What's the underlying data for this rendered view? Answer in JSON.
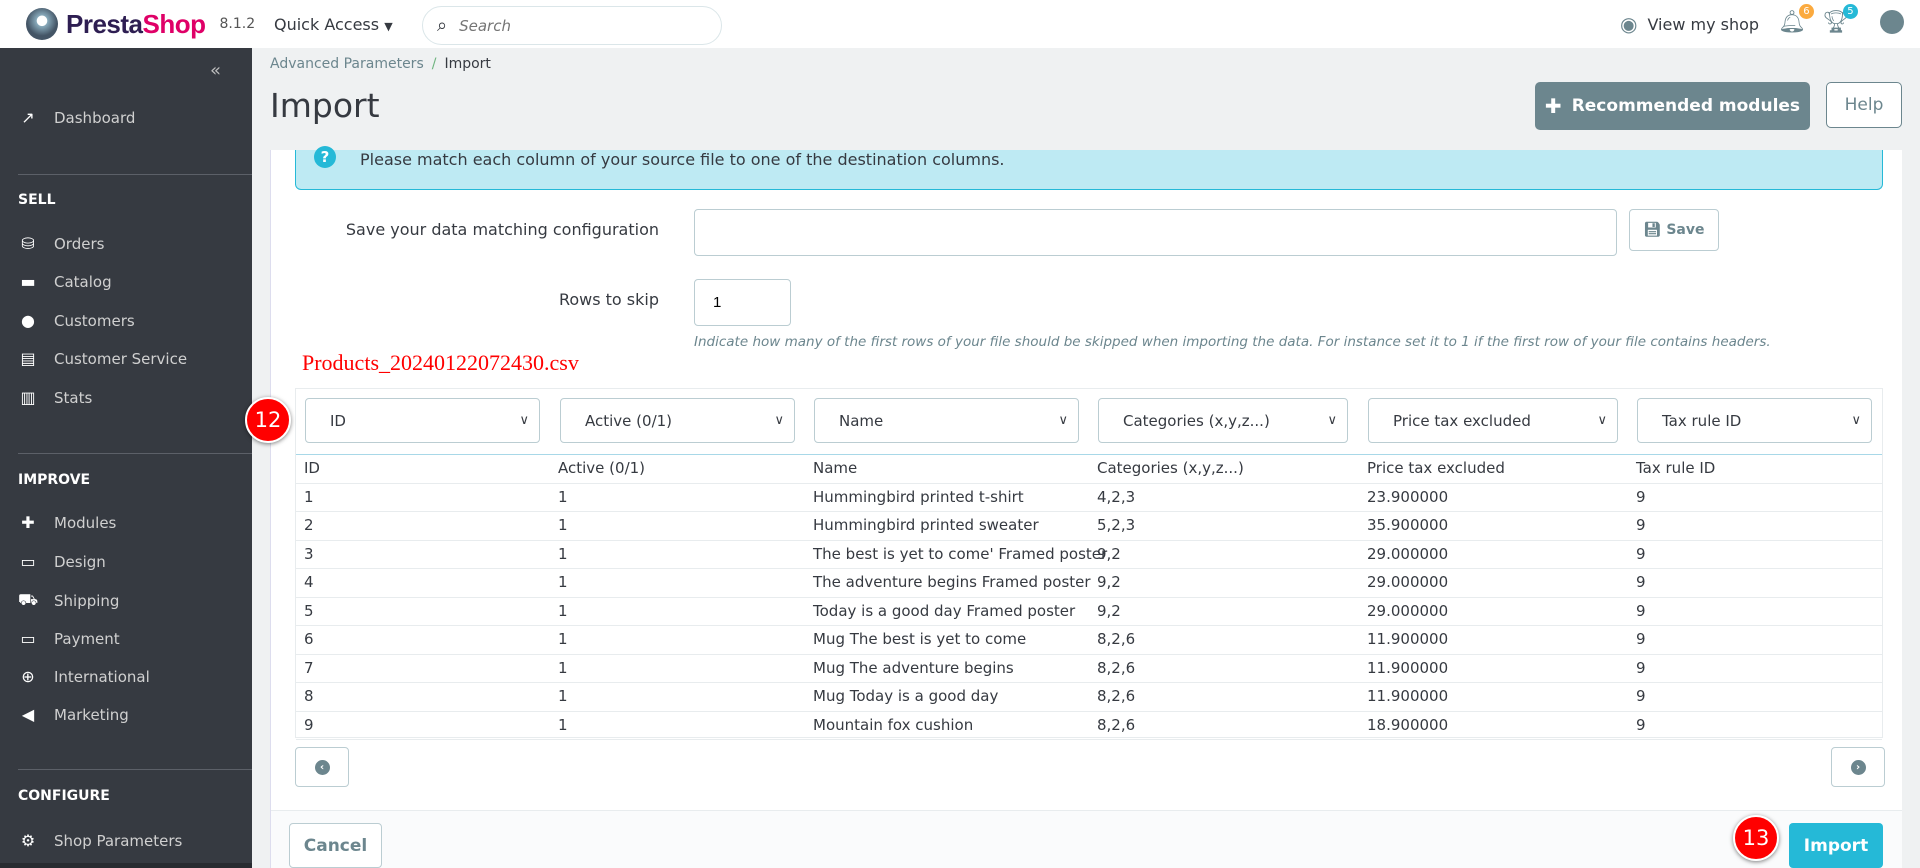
{
  "header": {
    "brand": "PrestaShop",
    "version": "8.1.2",
    "quick_access": "Quick Access",
    "search_placeholder": "Search",
    "view_shop": "View my shop",
    "notifications_count": "6",
    "trophy_count": "5"
  },
  "sidebar": {
    "top": [
      {
        "label": "Dashboard",
        "icon": "trending-up-icon"
      }
    ],
    "sections": [
      {
        "title": "SELL",
        "items": [
          {
            "label": "Orders",
            "icon": "basket-icon"
          },
          {
            "label": "Catalog",
            "icon": "store-icon"
          },
          {
            "label": "Customers",
            "icon": "account-circle-icon"
          },
          {
            "label": "Customer Service",
            "icon": "chat-icon"
          },
          {
            "label": "Stats",
            "icon": "bar-chart-icon"
          }
        ]
      },
      {
        "title": "IMPROVE",
        "items": [
          {
            "label": "Modules",
            "icon": "puzzle-icon"
          },
          {
            "label": "Design",
            "icon": "desktop-icon"
          },
          {
            "label": "Shipping",
            "icon": "truck-icon"
          },
          {
            "label": "Payment",
            "icon": "credit-card-icon"
          },
          {
            "label": "International",
            "icon": "globe-icon"
          },
          {
            "label": "Marketing",
            "icon": "megaphone-icon"
          }
        ]
      },
      {
        "title": "CONFIGURE",
        "items": [
          {
            "label": "Shop Parameters",
            "icon": "gear-icon"
          }
        ]
      }
    ]
  },
  "breadcrumb": {
    "parent": "Advanced Parameters",
    "separator": "/",
    "current": "Import"
  },
  "page": {
    "title": "Import",
    "recommended_modules": "Recommended modules",
    "help": "Help"
  },
  "form": {
    "info": "Please match each column of your source file to one of the destination columns.",
    "save_config_label": "Save your data matching configuration",
    "save_config_value": "",
    "save_button": "Save",
    "rows_skip_label": "Rows to skip",
    "rows_skip_value": "1",
    "rows_skip_hint": "Indicate how many of the first rows of your file should be skipped when importing the data. For instance set it to 1 if the first row of your file contains headers.",
    "filename": "Products_20240122072430.csv"
  },
  "table": {
    "selects": [
      "ID",
      "Active (0/1)",
      "Name",
      "Categories (x,y,z...)",
      "Price tax excluded",
      "Tax rule ID"
    ],
    "headers": [
      "ID",
      "Active (0/1)",
      "Name",
      "Categories (x,y,z...)",
      "Price tax excluded",
      "Tax rule ID"
    ],
    "rows": [
      [
        "1",
        "1",
        "Hummingbird printed t-shirt",
        "4,2,3",
        "23.900000",
        "9"
      ],
      [
        "2",
        "1",
        "Hummingbird printed sweater",
        "5,2,3",
        "35.900000",
        "9"
      ],
      [
        "3",
        "1",
        "The best is yet to come' Framed poster",
        "9,2",
        "29.000000",
        "9"
      ],
      [
        "4",
        "1",
        "The adventure begins Framed poster",
        "9,2",
        "29.000000",
        "9"
      ],
      [
        "5",
        "1",
        "Today is a good day Framed poster",
        "9,2",
        "29.000000",
        "9"
      ],
      [
        "6",
        "1",
        "Mug The best is yet to come",
        "8,2,6",
        "11.900000",
        "9"
      ],
      [
        "7",
        "1",
        "Mug The adventure begins",
        "8,2,6",
        "11.900000",
        "9"
      ],
      [
        "8",
        "1",
        "Mug Today is a good day",
        "8,2,6",
        "11.900000",
        "9"
      ],
      [
        "9",
        "1",
        "Mountain fox cushion",
        "8,2,6",
        "18.900000",
        "9"
      ]
    ]
  },
  "footer": {
    "cancel": "Cancel",
    "import": "Import"
  },
  "annotations": {
    "step_a": "12",
    "step_b": "13"
  },
  "colors": {
    "sidebar": "#363a41",
    "accent": "#25b9d7",
    "brand_pink": "#df0067",
    "step_badge": "#ff0000",
    "info_bg": "#beeaf3"
  }
}
